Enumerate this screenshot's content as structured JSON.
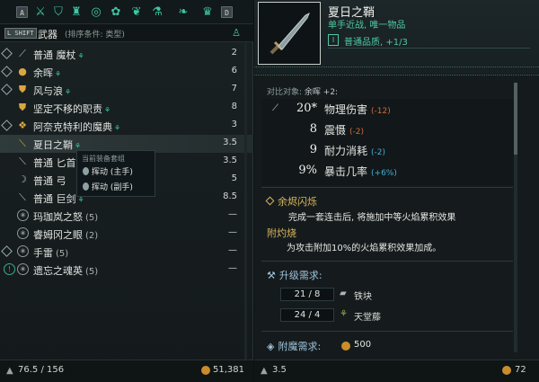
{
  "category_bar": {
    "left_key": "A",
    "right_key": "D",
    "icons": [
      "crossed-swords-icon",
      "shield-icon",
      "armor-icon",
      "rings-icon",
      "trinket-icon",
      "dragon-icon",
      "potion-icon",
      "scroll-icon",
      "crown-icon"
    ],
    "shift_key": "L SHIFT",
    "category_name": "武器",
    "sort_label": "(排序条件: 类型)"
  },
  "items": [
    {
      "name": "普通 魔杖",
      "mark": "⚘",
      "count": "",
      "weight": "2",
      "icon": "staff-icon",
      "fav": true
    },
    {
      "name": "余晖",
      "mark": "⚘",
      "count": "",
      "weight": "6",
      "icon": "coin-icon",
      "fav": true
    },
    {
      "name": "风与浪",
      "mark": "⚘",
      "count": "",
      "weight": "7",
      "icon": "shield-icon",
      "fav": true
    },
    {
      "name": "坚定不移的职责",
      "mark": "⚘",
      "count": "",
      "weight": "8",
      "icon": "shield-icon",
      "fav": false
    },
    {
      "name": "阿奈克特利的魔典",
      "mark": "⚘",
      "count": "",
      "weight": "3",
      "icon": "book-icon",
      "fav": true
    },
    {
      "name": "夏日之鞘",
      "mark": "⚘",
      "count": "",
      "weight": "3.5",
      "icon": "dagger-icon",
      "fav": false
    },
    {
      "name": "普通 匕首",
      "mark": "",
      "count": "",
      "weight": "3.5",
      "icon": "dagger-icon",
      "fav": false
    },
    {
      "name": "普通 弓",
      "mark": "",
      "count": "",
      "weight": "5",
      "icon": "bow-icon",
      "fav": false
    },
    {
      "name": "普通 巨剑",
      "mark": "⚘",
      "count": "",
      "weight": "8.5",
      "icon": "greatsword-icon",
      "fav": false
    },
    {
      "name": "玛珈岚之怒",
      "mark": "",
      "count": "(5)",
      "weight": "—",
      "icon": "bomb-icon",
      "fav": false
    },
    {
      "name": "睿姆冈之眼",
      "mark": "",
      "count": "(2)",
      "weight": "—",
      "icon": "bomb-icon",
      "fav": false
    },
    {
      "name": "手雷",
      "mark": "",
      "count": "(5)",
      "weight": "—",
      "icon": "grenade-icon",
      "fav": false
    },
    {
      "name": "遗忘之魂英",
      "mark": "",
      "count": "(5)",
      "weight": "—",
      "icon": "soul-icon",
      "fav": false
    }
  ],
  "tooltip": {
    "title": "当前装备套组",
    "items": [
      "挥动 (主手)",
      "挥动 (副手)"
    ]
  },
  "footer_left": {
    "weight": "76.5 / 156",
    "gold": "51,381"
  },
  "detail": {
    "name": "夏日之鞘",
    "type": "单手近战, 唯一物品",
    "quality_badge": "I",
    "quality": "普通品质, +1/3",
    "compare_label": "对比对象:",
    "compare_target": "余晖 +2:",
    "stats": [
      {
        "icon": "sword-stat-icon",
        "glyph": "⟋",
        "value": "20*",
        "label": "物理伤害",
        "diff": "(-12)",
        "positive": false
      },
      {
        "icon": "stagger-icon",
        "glyph": "",
        "value": "8",
        "label": "震慑",
        "diff": "(-2)",
        "positive": false
      },
      {
        "icon": "stamina-icon",
        "glyph": "",
        "value": "9",
        "label": "耐力消耗",
        "diff": "(-2)",
        "positive": true
      },
      {
        "icon": "crit-icon",
        "glyph": "",
        "value": "9%",
        "label": "暴击几率",
        "diff": "(+6%)",
        "positive": true
      }
    ],
    "perk1_title": "余烬闪烁",
    "perk1_desc": "完成一套连击后, 将施加中等火焰累积效果",
    "perk2_title": "附灼烧",
    "perk2_desc": "为攻击附加10%的火焰累积效果加成。",
    "upgrade_title": "升级需求:",
    "materials": [
      {
        "amount": "21 / 8",
        "name": "铁块",
        "icon": "iron-ingot-icon"
      },
      {
        "amount": "24 / 4",
        "name": "天堂藤",
        "icon": "herb-icon"
      }
    ],
    "enchant_title": "附魔需求:",
    "enchant_cost": "500"
  },
  "footer_right": {
    "weight": "3.5",
    "gold": "72"
  }
}
